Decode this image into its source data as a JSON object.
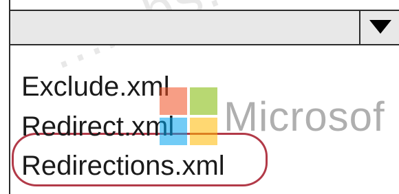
{
  "combo": {
    "selected_value": "",
    "dropdown_icon": "triangle-down-icon"
  },
  "list": {
    "items": [
      {
        "label": "Exclude.xml"
      },
      {
        "label": "Redirect.xml"
      },
      {
        "label": "Redirections.xml",
        "highlighted": true
      }
    ]
  },
  "watermark": {
    "brand_text": "Microsof",
    "diagonal_text": "...mbs.com",
    "logo_colors": [
      "#f25022",
      "#7fba00",
      "#00a4ef",
      "#ffb900"
    ]
  },
  "colors": {
    "highlight_ring": "#b23a48",
    "header_bg": "#e8e8e8"
  }
}
